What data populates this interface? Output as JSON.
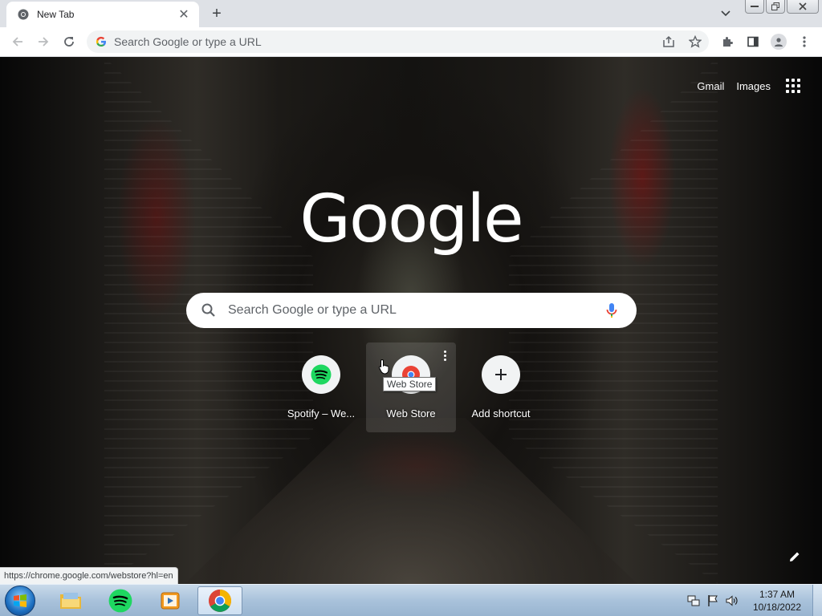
{
  "tab": {
    "title": "New Tab"
  },
  "toolbar": {
    "omnibox_placeholder": "Search Google or type a URL"
  },
  "ntp": {
    "links": {
      "gmail": "Gmail",
      "images": "Images"
    },
    "logo": "Google",
    "search_placeholder": "Search Google or type a URL",
    "shortcuts": [
      {
        "title": "Spotify – We...",
        "icon": "spotify-icon"
      },
      {
        "title": "Web Store",
        "icon": "web-store-icon"
      },
      {
        "title": "Add shortcut",
        "icon": "plus-icon"
      }
    ],
    "tooltip": "Web Store"
  },
  "status_bubble": "https://chrome.google.com/webstore?hl=en",
  "taskbar": {
    "clock_time": "1:37 AM",
    "clock_date": "10/18/2022"
  },
  "colors": {
    "spotify": "#1ed760",
    "chrome_red": "#db4437",
    "chrome_yellow": "#f4b400",
    "chrome_green": "#0f9d58",
    "chrome_blue": "#4285f4"
  }
}
